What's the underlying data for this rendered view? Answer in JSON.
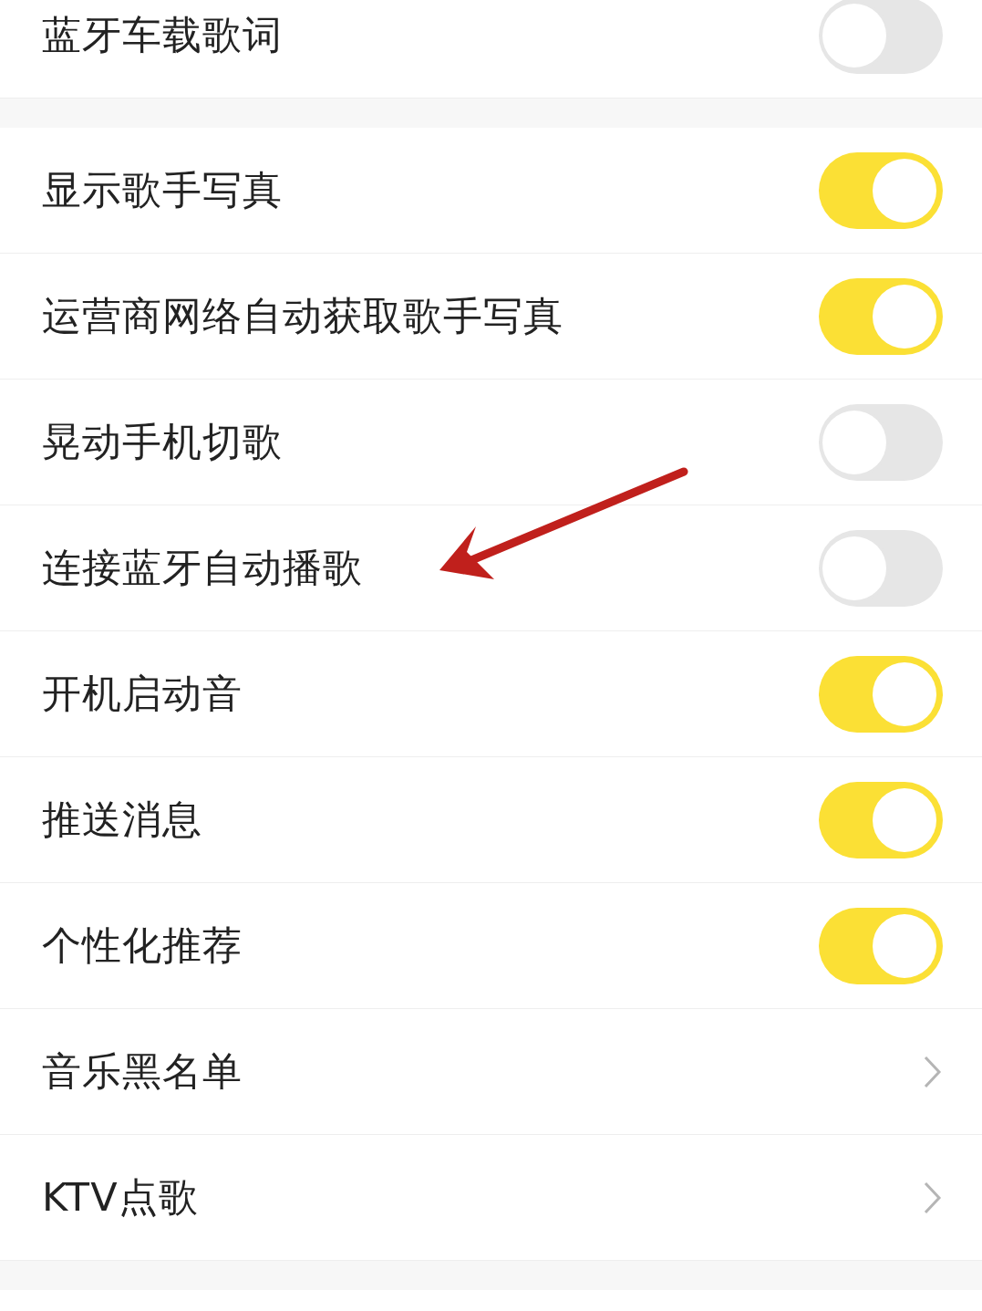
{
  "sections": [
    {
      "items": [
        {
          "kind": "toggle",
          "label": "蓝牙车载歌词",
          "on": false
        }
      ]
    },
    {
      "items": [
        {
          "kind": "toggle",
          "label": "显示歌手写真",
          "on": true
        },
        {
          "kind": "toggle",
          "label": "运营商网络自动获取歌手写真",
          "on": true
        },
        {
          "kind": "toggle",
          "label": "晃动手机切歌",
          "on": false
        },
        {
          "kind": "toggle",
          "label": "连接蓝牙自动播歌",
          "on": false
        },
        {
          "kind": "toggle",
          "label": "开机启动音",
          "on": true
        },
        {
          "kind": "toggle",
          "label": "推送消息",
          "on": true
        },
        {
          "kind": "toggle",
          "label": "个性化推荐",
          "on": true
        },
        {
          "kind": "link",
          "label": "音乐黑名单"
        },
        {
          "kind": "link",
          "label": "KTV点歌"
        }
      ]
    }
  ]
}
